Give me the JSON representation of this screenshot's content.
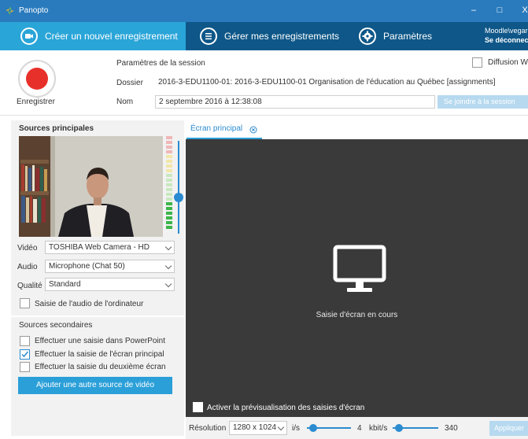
{
  "window": {
    "title": "Panopto",
    "minimize": "–",
    "maximize": "□",
    "close": "X"
  },
  "nav": {
    "tabs": [
      {
        "label": "Créer un nouvel enregistrement",
        "active": true
      },
      {
        "label": "Gérer mes enregistrements",
        "active": false
      },
      {
        "label": "Paramètres",
        "active": false
      }
    ],
    "user": "Moodle\\vegare",
    "logout": "Se déconnect"
  },
  "session": {
    "record_label": "Enregistrer",
    "heading": "Paramètres de la session",
    "folder_label": "Dossier",
    "folder_value": "2016-3-EDU1100-01: 2016-3-EDU1100-01 Organisation de l'éducation au Québec [assignments]",
    "name_label": "Nom",
    "name_value": "2 septembre 2016 à 12:38:08",
    "join_button": "Se joindre à la session",
    "webcast_label": "Diffusion W"
  },
  "primary_sources": {
    "title": "Sources principales",
    "video_label": "Vidéo",
    "video_value": "TOSHIBA Web Camera - HD",
    "audio_label": "Audio",
    "audio_value": "Microphone (Chat 50)",
    "quality_label": "Qualité",
    "quality_value": "Standard",
    "computer_audio_label": "Saisie de l'audio de l'ordinateur",
    "computer_audio_checked": false,
    "vu_level_fraction": 0.3,
    "volume_fraction": 0.42
  },
  "secondary_sources": {
    "title": "Sources secondaires",
    "options": [
      {
        "label": "Effectuer une saisie dans PowerPoint",
        "checked": false
      },
      {
        "label": "Effectuer la saisie de l'écran principal",
        "checked": true
      },
      {
        "label": "Effectuer la saisie du deuxième écran",
        "checked": false
      }
    ],
    "add_button": "Ajouter une autre source de vidéo"
  },
  "screen": {
    "tab_label": "Écran principal",
    "status": "Saisie d'écran en cours",
    "preview_label": "Activer la prévisualisation des saisies d'écran",
    "preview_checked": false
  },
  "bottom": {
    "resolution_label": "Résolution",
    "resolution_value": "1280 x 1024",
    "fps_label": "i/s",
    "fps_value": "4",
    "bitrate_label": "kbit/s",
    "bitrate_value": "340",
    "apply_button": "Appliquer"
  },
  "colors": {
    "titlebar": "#2a7bbd",
    "navbar": "#0e5788",
    "nav_active": "#2aa5d8",
    "record": "#e8302a",
    "accent": "#2b9fd8"
  }
}
